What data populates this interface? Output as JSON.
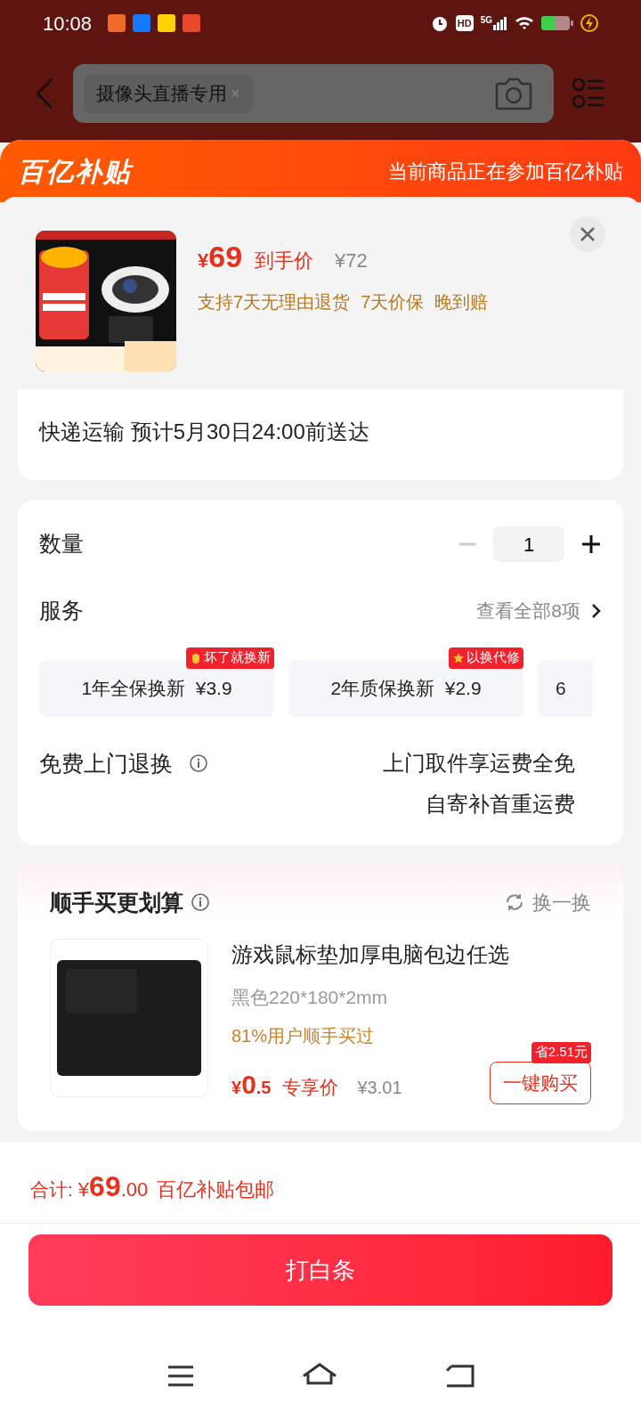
{
  "status_bar": {
    "time": "10:08",
    "hd": "HD",
    "network": "5G"
  },
  "search": {
    "chip": "摄像头直播专用",
    "chip_close": "×"
  },
  "banner": {
    "logo": "百亿补贴",
    "note": "当前商品正在参加百亿补贴"
  },
  "product": {
    "price_symbol": "¥",
    "price": "69",
    "price_label": "到手价",
    "original_price": "¥72",
    "guarantees": [
      "支持7天无理由退货",
      "7天价保",
      "晚到赔"
    ]
  },
  "delivery": {
    "text": "快递运输 预计5月30日24:00前送达"
  },
  "quantity": {
    "label": "数量",
    "value": "1",
    "decrease_disabled": true
  },
  "services": {
    "label": "服务",
    "view_all": "查看全部8项",
    "options": [
      {
        "text": "1年全保换新  ¥3.9",
        "badge": {
          "kind": "hand",
          "text": "坏了就换新"
        }
      },
      {
        "text": "2年质保换新  ¥2.9",
        "badge": {
          "kind": "star",
          "text": "以换代修"
        }
      },
      {
        "text": "6"
      }
    ]
  },
  "return_service": {
    "label": "免费上门退换",
    "lines": [
      "上门取件享运费全免",
      "自寄补首重运费"
    ]
  },
  "bundle": {
    "title": "顺手买更划算",
    "refresh": "换一换",
    "item": {
      "name": "游戏鼠标垫加厚电脑包边任选",
      "spec": "黑色220*180*2mm",
      "social": "81%用户顺手买过",
      "price_symbol": "¥",
      "price_int": "0",
      "price_dec": ".5",
      "price_label": "专享价",
      "original_price": "¥3.01",
      "button": "一键购买",
      "save_badge": "省2.51元"
    }
  },
  "footer": {
    "total_label": "合计:",
    "symbol": "¥",
    "amount": "69",
    "decimals": ".00",
    "note": "百亿补贴包邮",
    "button": "打白条"
  }
}
